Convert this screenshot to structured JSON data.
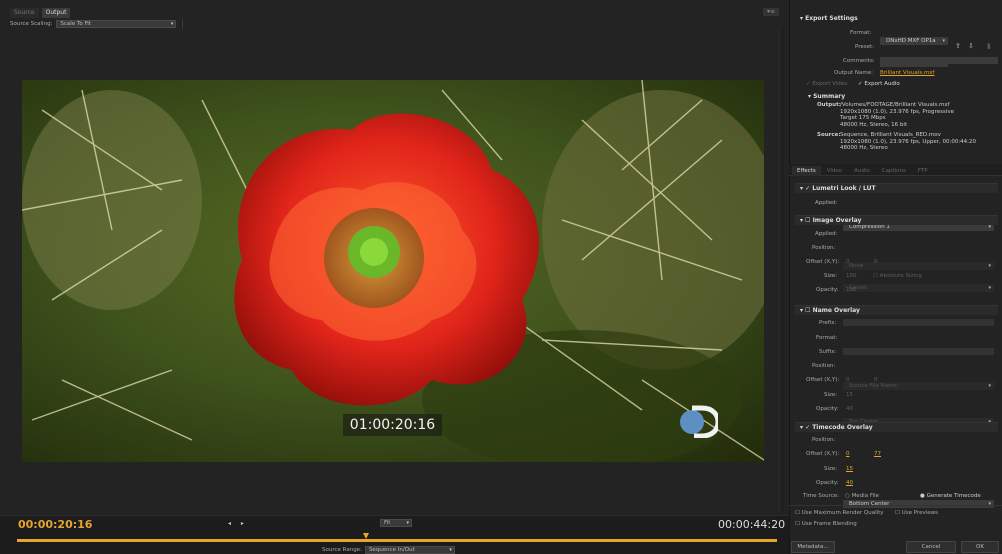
{
  "source_tabs": [
    "Source",
    "Output"
  ],
  "menu_button": "▾≡",
  "source_scaling": {
    "label": "Source Scaling:",
    "value": "Scale To Fit"
  },
  "overlay_timecode": "01:00:20:16",
  "current_time": "00:00:20:16",
  "duration": "00:00:44:20",
  "zoom": "Fit",
  "mark_icons": "◂ ▸",
  "source_range": {
    "label": "Source Range:",
    "value": "Sequence In/Out"
  },
  "export_settings": {
    "title": "Export Settings",
    "format_label": "Format:",
    "format": "DNxHD MXF OP1a",
    "preset_label": "Preset:",
    "preset": "Custom",
    "comments_label": "Comments:",
    "output_name_label": "Output Name:",
    "output_name": "Brilliant Visuals.mxf",
    "export_video": "Export Video",
    "export_audio": "Export Audio"
  },
  "summary": {
    "title": "Summary",
    "output_label": "Output:",
    "output_lines": [
      "/Volumes/FOOTAGE/Brilliant Visuals.mxf",
      "1920x1080 (1.0), 23.976 fps, Progressive",
      "Target 175 Mbps",
      "48000 Hz, Stereo, 16 bit"
    ],
    "source_label": "Source:",
    "source_lines": [
      "Sequence, Brilliant Visuals_RED.mov",
      "1920x1080 (1.0), 23.976 fps, Upper, 00:00:44:20",
      "48000 Hz, Stereo"
    ]
  },
  "effect_tabs": [
    "Effects",
    "Video",
    "Audio",
    "Captions",
    "FTP"
  ],
  "lumetri": {
    "title": "Lumetri Look / LUT",
    "applied_label": "Applied:",
    "applied": "Compression 1"
  },
  "image_overlay": {
    "title": "Image Overlay",
    "applied_label": "Applied:",
    "applied": "None",
    "position_label": "Position:",
    "position": "Center",
    "offset_label": "Offset (X,Y):",
    "offset_x": "0",
    "offset_y": "0",
    "size_label": "Size:",
    "size": "100",
    "absolute_sizing": "Absolute Sizing",
    "opacity_label": "Opacity:",
    "opacity": "100"
  },
  "name_overlay": {
    "title": "Name Overlay",
    "prefix_label": "Prefix:",
    "format_label": "Format:",
    "format": "Source File Name",
    "suffix_label": "Suffix:",
    "position_label": "Position:",
    "position": "Top Center",
    "offset_label": "Offset (X,Y):",
    "offset_x": "0",
    "offset_y": "0",
    "size_label": "Size:",
    "size": "15",
    "opacity_label": "Opacity:",
    "opacity": "40"
  },
  "timecode_overlay": {
    "title": "Timecode Overlay",
    "position_label": "Position:",
    "position": "Bottom Center",
    "offset_label": "Offset (X,Y):",
    "offset_x": "0",
    "offset_y": "77",
    "size_label": "Size:",
    "size": "15",
    "opacity_label": "Opacity:",
    "opacity": "40",
    "time_source_label": "Time Source:",
    "media_file": "Media File",
    "generate_timecode": "Generate Timecode"
  },
  "options": {
    "max_render": "Use Maximum Render Quality",
    "use_previews": "Use Previews",
    "frame_blending": "Use Frame Blending"
  },
  "buttons": {
    "metadata": "Metadata...",
    "cancel": "Cancel",
    "ok": "OK"
  },
  "colors": {
    "accent": "#e6a52b",
    "panel": "#232323"
  }
}
